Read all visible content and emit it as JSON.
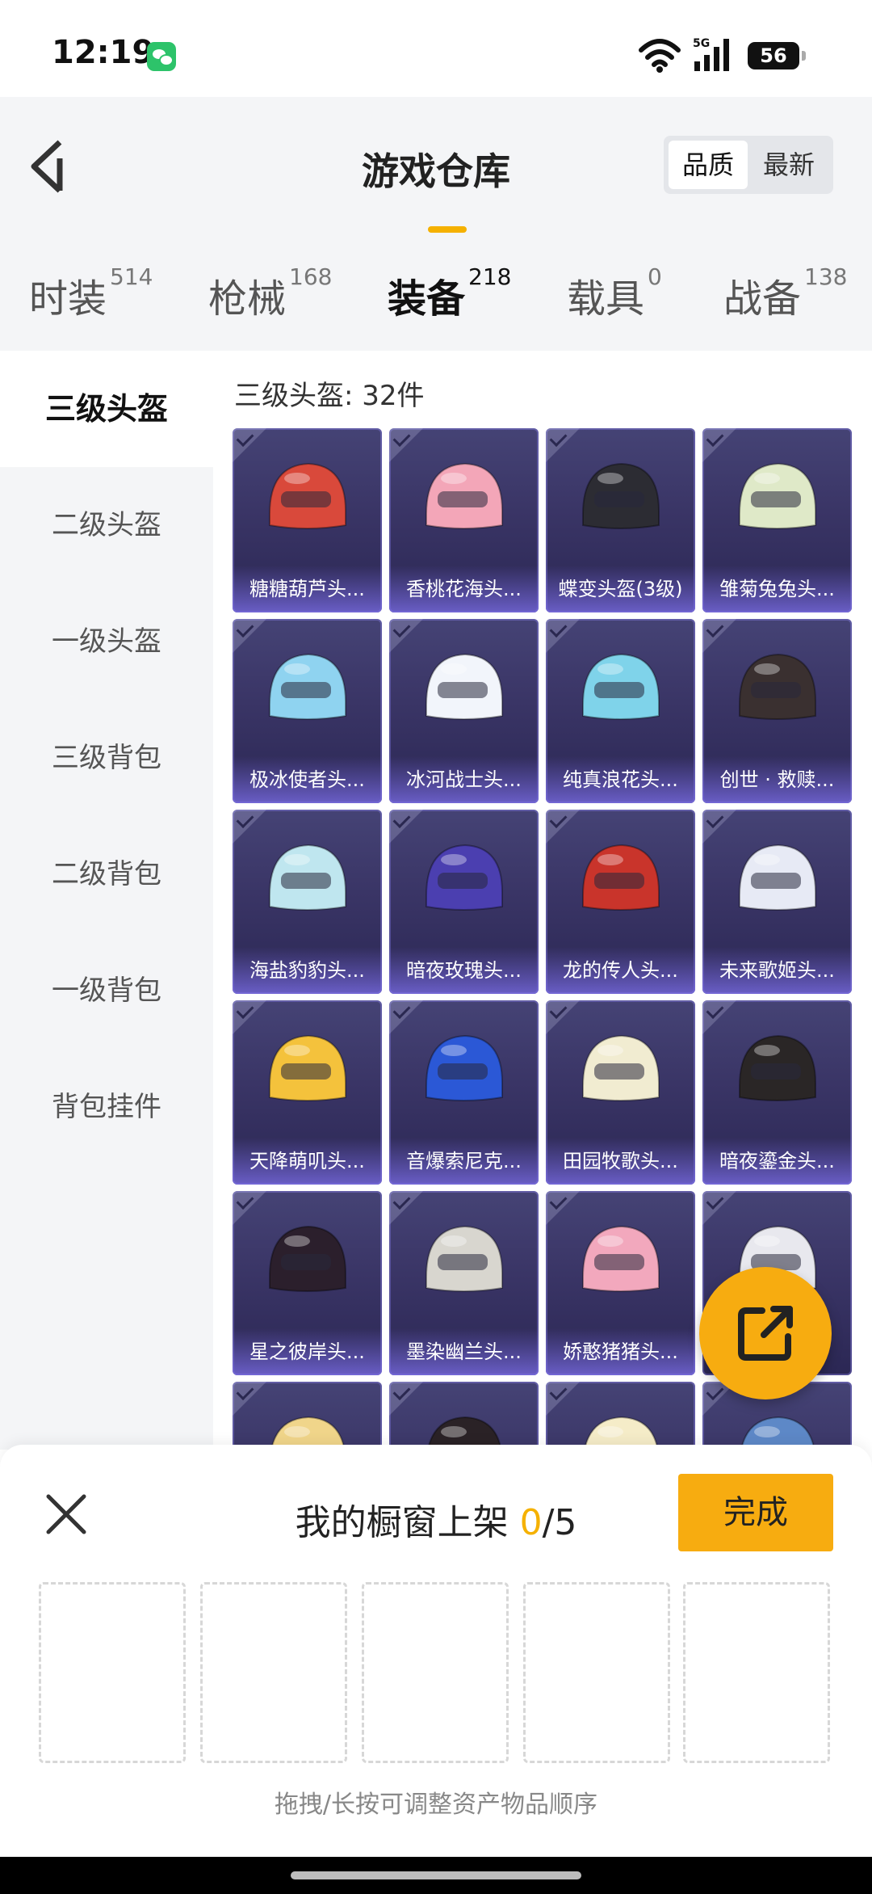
{
  "status_bar": {
    "time": "12:19",
    "network": "5G",
    "battery": "56"
  },
  "header": {
    "title": "游戏仓库",
    "sort_options": [
      "品质",
      "最新"
    ],
    "sort_selected": "品质"
  },
  "tabs": [
    {
      "label": "时装",
      "count": "514"
    },
    {
      "label": "枪械",
      "count": "168"
    },
    {
      "label": "装备",
      "count": "218"
    },
    {
      "label": "载具",
      "count": "0"
    },
    {
      "label": "战备",
      "count": "138"
    }
  ],
  "active_tab": "装备",
  "sidebar": {
    "items": [
      "三级头盔",
      "二级头盔",
      "一级头盔",
      "三级背包",
      "二级背包",
      "一级背包",
      "背包挂件"
    ],
    "active": "三级头盔"
  },
  "section_title": "三级头盔: 32件",
  "items": [
    {
      "name": "糖糖葫芦头...",
      "color": "#d9493b"
    },
    {
      "name": "香桃花海头...",
      "color": "#f3a6b8"
    },
    {
      "name": "蝶变头盔(3级)",
      "color": "#2c2c33"
    },
    {
      "name": "雏菊兔兔头...",
      "color": "#dfe9c8"
    },
    {
      "name": "极冰使者头...",
      "color": "#8fd3f0"
    },
    {
      "name": "冰河战士头...",
      "color": "#f2f5fb"
    },
    {
      "name": "纯真浪花头...",
      "color": "#7fd3ea"
    },
    {
      "name": "创世 · 救赎...",
      "color": "#3a3030"
    },
    {
      "name": "海盐豹豹头...",
      "color": "#bfe6ef"
    },
    {
      "name": "暗夜玫瑰头...",
      "color": "#4b3fb0"
    },
    {
      "name": "龙的传人头...",
      "color": "#c9342b"
    },
    {
      "name": "未来歌姬头...",
      "color": "#e7eaf5"
    },
    {
      "name": "天降萌叽头...",
      "color": "#f4c23c"
    },
    {
      "name": "音爆索尼克...",
      "color": "#2b58d6"
    },
    {
      "name": "田园牧歌头...",
      "color": "#f1ecd1"
    },
    {
      "name": "暗夜鎏金头...",
      "color": "#2a2626"
    },
    {
      "name": "星之彼岸头...",
      "color": "#2b1f2c"
    },
    {
      "name": "墨染幽兰头...",
      "color": "#d8d6cf"
    },
    {
      "name": "娇憨猪猪头...",
      "color": "#f2a8bd"
    },
    {
      "name": "",
      "color": "#e8e8ee"
    },
    {
      "name": "",
      "color": "#f0d58a"
    },
    {
      "name": "",
      "color": "#2a2226"
    },
    {
      "name": "",
      "color": "#f5ecc8"
    },
    {
      "name": "",
      "color": "#5d88c7"
    }
  ],
  "showcase": {
    "title_prefix": "我的橱窗上架 ",
    "count": "0",
    "total": "/5",
    "done_label": "完成",
    "slots": 5,
    "hint": "拖拽/长按可调整资产物品顺序"
  },
  "colors": {
    "accent": "#f5b100",
    "button": "#f7ac10",
    "card_dark": "#2b2754"
  }
}
